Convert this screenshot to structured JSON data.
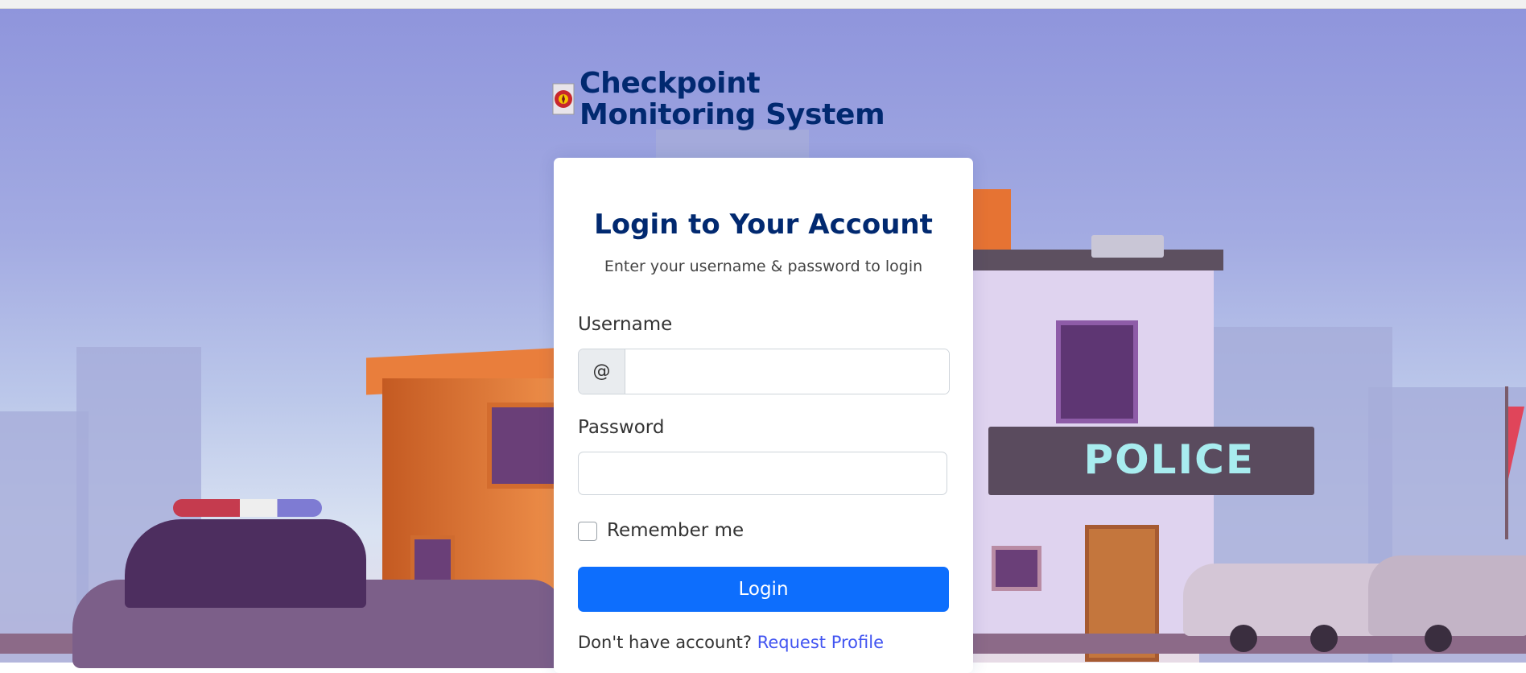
{
  "brand": {
    "title": "Checkpoint Monitoring System"
  },
  "scene": {
    "sign_text": "POLICE"
  },
  "login": {
    "title": "Login to Your Account",
    "subtitle": "Enter your username & password to login",
    "username_label": "Username",
    "username_prefix": "@",
    "username_value": "",
    "password_label": "Password",
    "password_value": "",
    "remember_label": "Remember me",
    "remember_checked": false,
    "login_button": "Login",
    "footer_text": "Don't have account?",
    "footer_link": "Request Profile"
  },
  "colors": {
    "brand": "#012970",
    "primary": "#0d6efd",
    "link": "#4154f1"
  }
}
